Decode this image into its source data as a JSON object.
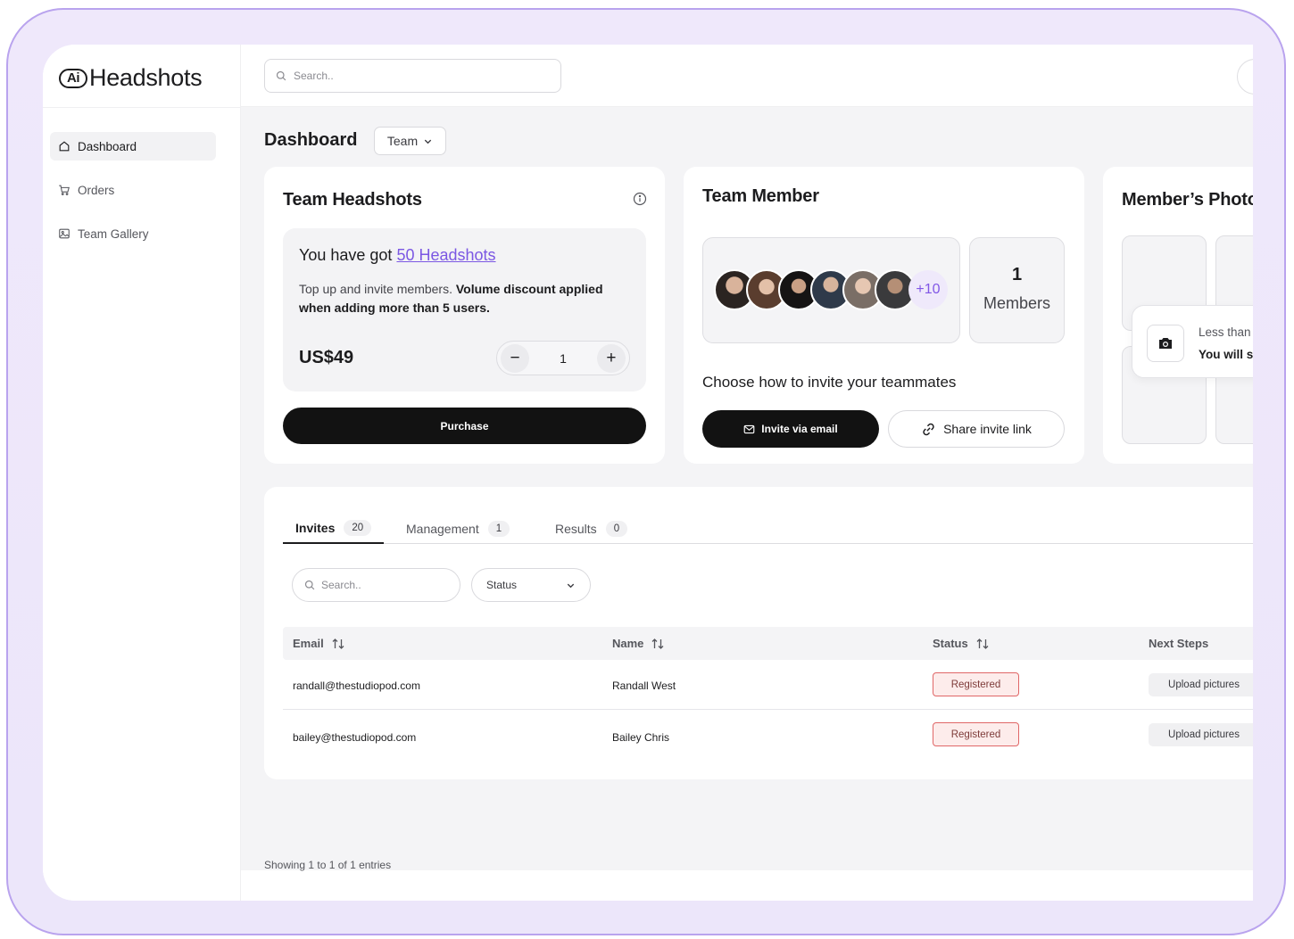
{
  "brand": {
    "badge": "Ai",
    "name": "Headshots"
  },
  "sidebar": {
    "items": [
      {
        "label": "Dashboard",
        "icon": "home-icon",
        "active": true
      },
      {
        "label": "Orders",
        "icon": "cart-icon",
        "active": false
      },
      {
        "label": "Team Gallery",
        "icon": "gallery-icon",
        "active": false
      }
    ]
  },
  "topbar": {
    "search_placeholder": "Search.."
  },
  "page": {
    "title": "Dashboard",
    "scope_select": "Team"
  },
  "team_headshots": {
    "title": "Team Headshots",
    "got_prefix": "You have got",
    "got_link": "50 Headshots",
    "desc_plain": "Top up and invite members.",
    "desc_bold": "Volume discount applied when adding more than 5 users.",
    "price": "US$49",
    "quantity": "1",
    "minus": "−",
    "plus": "+",
    "purchase_label": "Purchase"
  },
  "team_member": {
    "title": "Team Member",
    "more_count": "+10",
    "members_count": "1",
    "members_label": "Members",
    "choose_label": "Choose how to invite your teammates",
    "invite_email_label": "Invite via email",
    "share_link_label": "Share invite link"
  },
  "members_photo": {
    "title": "Member’s Photo",
    "toast_line1": "Less than",
    "toast_line2": "You will s"
  },
  "tabs": [
    {
      "label": "Invites",
      "count": "20",
      "active": true
    },
    {
      "label": "Management",
      "count": "1",
      "active": false
    },
    {
      "label": "Results",
      "count": "0",
      "active": false
    }
  ],
  "filters": {
    "search_placeholder": "Search..",
    "status_label": "Status"
  },
  "table": {
    "columns": [
      "Email",
      "Name",
      "Status",
      "Next Steps"
    ],
    "rows": [
      {
        "email": "randall@thestudiopod.com",
        "name": "Randall West",
        "status": "Registered",
        "next": "Upload pictures"
      },
      {
        "email": "bailey@thestudiopod.com",
        "name": "Bailey Chris",
        "status": "Registered",
        "next": "Upload pictures"
      }
    ]
  },
  "footer": {
    "entries": "Showing 1 to 1 of 1 entries"
  },
  "colors": {
    "accent": "#7b57e3",
    "frame_border": "#b9a3ee",
    "badge_border": "#e06767"
  }
}
